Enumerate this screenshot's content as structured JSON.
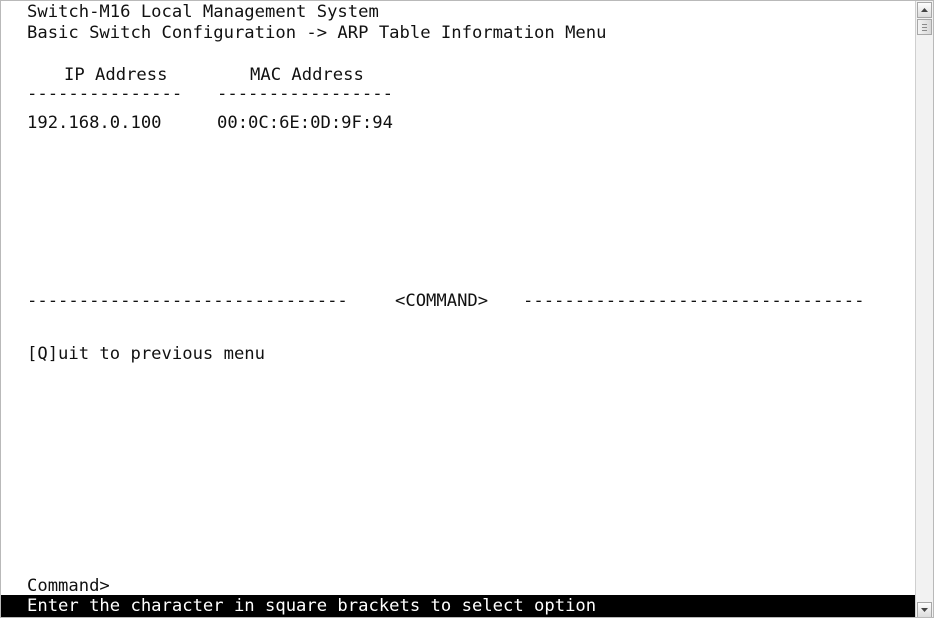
{
  "terminal": {
    "system_title": "Switch-M16 Local Management System",
    "breadcrumb": "Basic Switch Configuration -> ARP Table Information Menu",
    "table": {
      "columns": [
        {
          "label": "IP Address",
          "underline": "---------------"
        },
        {
          "label": "MAC Address",
          "underline": "-----------------"
        }
      ],
      "rows": [
        {
          "ip": "192.168.0.100",
          "mac": "00:0C:6E:0D:9F:94"
        }
      ]
    },
    "command_divider": {
      "left": "-------------------------------",
      "label": "<COMMAND>",
      "right": "---------------------------------"
    },
    "commands": [
      {
        "label": "[Q]uit to previous menu"
      }
    ],
    "prompt": "Command>",
    "status_message": "Enter the character in square brackets to select option"
  },
  "scrollbar": {
    "up_icon": "arrow-up-icon",
    "down_icon": "arrow-down-icon",
    "thumb_position": 0
  }
}
